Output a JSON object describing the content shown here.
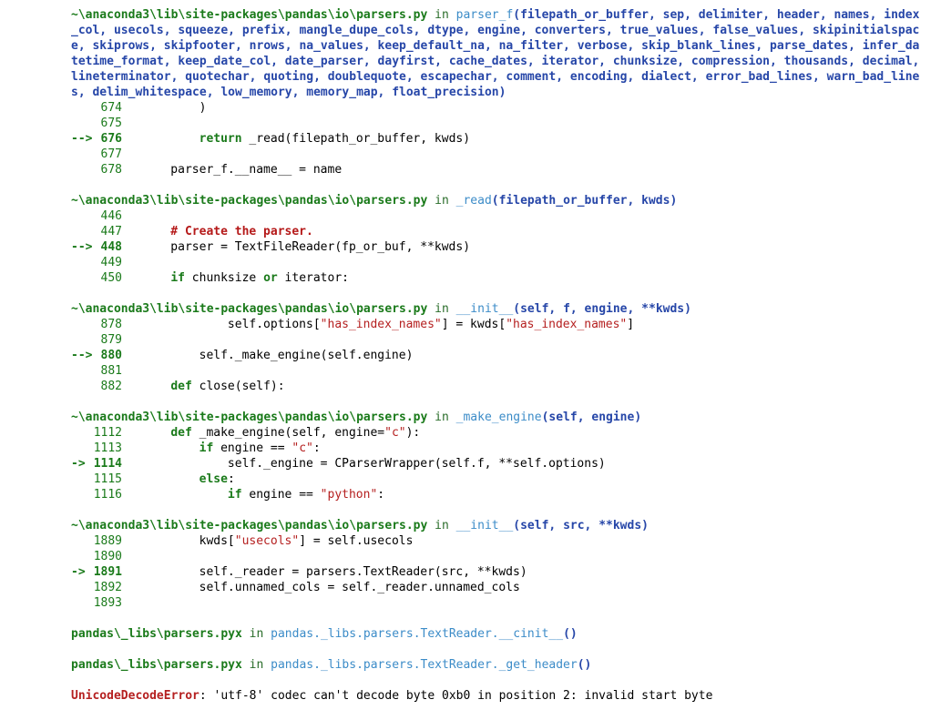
{
  "colors": {
    "path": "#1a7a1a",
    "function": "#3c8cc8",
    "args": "#2646a8",
    "string": "#b52020",
    "comment": "#b51919",
    "error": "#b52020"
  },
  "frames": [
    {
      "path": "~\\anaconda3\\lib\\site-packages\\pandas\\io\\parsers.py",
      "in": "in",
      "func": "parser_f",
      "args": "(filepath_or_buffer, sep, delimiter, header, names, index_col, usecols, squeeze, prefix, mangle_dupe_cols, dtype, engine, converters, true_values, false_values, skipinitialspace, skiprows, skipfooter, nrows, na_values, keep_default_na, na_filter, verbose, skip_blank_lines, parse_dates, infer_datetime_format, keep_date_col, date_parser, dayfirst, cache_dates, iterator, chunksize, compression, thousands, decimal, lineterminator, quotechar, quoting, doublequote, escapechar, comment, encoding, dialect, error_bad_lines, warn_bad_lines, delim_whitespace, low_memory, memory_map, float_precision)",
      "lines": [
        {
          "arrow": "",
          "no": "674",
          "code": "        )"
        },
        {
          "arrow": "",
          "no": "675",
          "code": ""
        },
        {
          "arrow": "-->",
          "no": "676",
          "code": "        return _read(filepath_or_buffer, kwds)"
        },
        {
          "arrow": "",
          "no": "677",
          "code": ""
        },
        {
          "arrow": "",
          "no": "678",
          "code": "    parser_f.__name__ = name"
        }
      ]
    },
    {
      "path": "~\\anaconda3\\lib\\site-packages\\pandas\\io\\parsers.py",
      "in": "in",
      "func": "_read",
      "args": "(filepath_or_buffer, kwds)",
      "lines": [
        {
          "arrow": "",
          "no": "446",
          "code": ""
        },
        {
          "arrow": "",
          "no": "447",
          "code": "    # Create the parser."
        },
        {
          "arrow": "-->",
          "no": "448",
          "code": "    parser = TextFileReader(fp_or_buf, **kwds)"
        },
        {
          "arrow": "",
          "no": "449",
          "code": ""
        },
        {
          "arrow": "",
          "no": "450",
          "code": "    if chunksize or iterator:"
        }
      ]
    },
    {
      "path": "~\\anaconda3\\lib\\site-packages\\pandas\\io\\parsers.py",
      "in": "in",
      "func": "__init__",
      "args": "(self, f, engine, **kwds)",
      "lines": [
        {
          "arrow": "",
          "no": "878",
          "code": "            self.options[\"has_index_names\"] = kwds[\"has_index_names\"]"
        },
        {
          "arrow": "",
          "no": "879",
          "code": ""
        },
        {
          "arrow": "-->",
          "no": "880",
          "code": "        self._make_engine(self.engine)"
        },
        {
          "arrow": "",
          "no": "881",
          "code": ""
        },
        {
          "arrow": "",
          "no": "882",
          "code": "    def close(self):"
        }
      ]
    },
    {
      "path": "~\\anaconda3\\lib\\site-packages\\pandas\\io\\parsers.py",
      "in": "in",
      "func": "_make_engine",
      "args": "(self, engine)",
      "lines": [
        {
          "arrow": "",
          "no": "1112",
          "code": "    def _make_engine(self, engine=\"c\"):"
        },
        {
          "arrow": "",
          "no": "1113",
          "code": "        if engine == \"c\":"
        },
        {
          "arrow": "->",
          "no": "1114",
          "code": "            self._engine = CParserWrapper(self.f, **self.options)"
        },
        {
          "arrow": "",
          "no": "1115",
          "code": "        else:"
        },
        {
          "arrow": "",
          "no": "1116",
          "code": "            if engine == \"python\":"
        }
      ]
    },
    {
      "path": "~\\anaconda3\\lib\\site-packages\\pandas\\io\\parsers.py",
      "in": "in",
      "func": "__init__",
      "args": "(self, src, **kwds)",
      "lines": [
        {
          "arrow": "",
          "no": "1889",
          "code": "        kwds[\"usecols\"] = self.usecols"
        },
        {
          "arrow": "",
          "no": "1890",
          "code": ""
        },
        {
          "arrow": "->",
          "no": "1891",
          "code": "        self._reader = parsers.TextReader(src, **kwds)"
        },
        {
          "arrow": "",
          "no": "1892",
          "code": "        self.unnamed_cols = self._reader.unnamed_cols"
        },
        {
          "arrow": "",
          "no": "1893",
          "code": ""
        }
      ]
    }
  ],
  "pyx_frames": [
    {
      "path": "pandas\\_libs\\parsers.pyx",
      "in": "in",
      "func": "pandas._libs.parsers.TextReader.__cinit__",
      "args": "()"
    },
    {
      "path": "pandas\\_libs\\parsers.pyx",
      "in": "in",
      "func": "pandas._libs.parsers.TextReader._get_header",
      "args": "()"
    }
  ],
  "error": {
    "name": "UnicodeDecodeError",
    "message": ": 'utf-8' codec can't decode byte 0xb0 in position 2: invalid start byte"
  }
}
